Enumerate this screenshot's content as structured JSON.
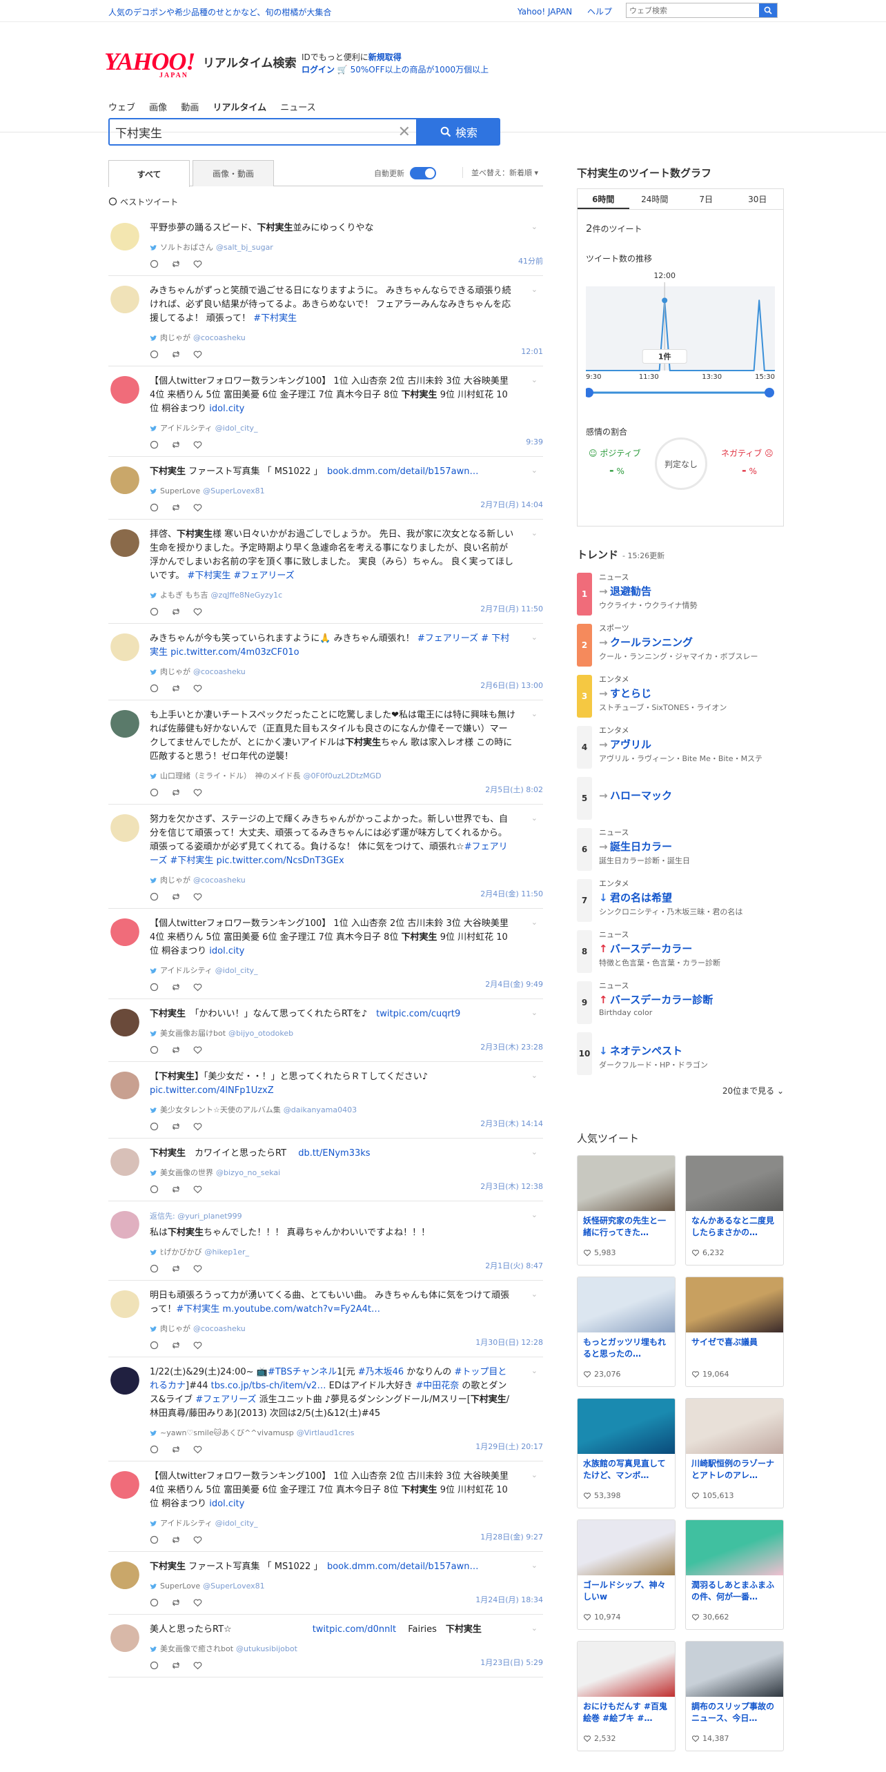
{
  "topbar": {
    "promo": "人気のデコポンや希少品種のせとかなど、旬の柑橘が大集合",
    "links": [
      "Yahoo! JAPAN",
      "ヘルプ"
    ],
    "web_search_placeholder": "ウェブ検索"
  },
  "header": {
    "logo": "YAHOO!",
    "logo_sub": "JAPAN",
    "title": "リアルタイム検索",
    "login_line1_a": "IDでもっと便利に",
    "login_line1_b": "新規取得",
    "login_line2_a": "ログイン",
    "login_line2_b": "50%OFF以上の商品が1000万個以上"
  },
  "nav": [
    "ウェブ",
    "画像",
    "動画",
    "リアルタイム",
    "ニュース"
  ],
  "search": {
    "value": "下村実生",
    "button": "検索"
  },
  "tabs": {
    "all": "すべて",
    "media": "画像・動画",
    "auto": "自動更新",
    "sort": "並べ替え：新着順"
  },
  "best_label": "ベストツイート",
  "tweets": [
    {
      "text": "平野歩夢の踊るスピード、<b>下村実生</b>並みにゆっくりやな",
      "user": "ソルトおばさん",
      "handle": "@salt_bj_sugar",
      "time": "41分前",
      "av": "#f3e6b0"
    },
    {
      "text": "みきちゃんがずっと笑顔で過ごせる日になりますように。 みきちゃんならできる&#xfe0f;頑張り続ければ、必ず良い結果が待ってるよ。あきらめないで！ フェアラーみんなみきちゃんを応援してるよ！ 頑張って！ <a>#下村実生</a>",
      "user": "肉じゃが",
      "handle": "@cocoasheku",
      "time": "12:01",
      "av": "#f0e2b8"
    },
    {
      "text": "【個人twitterフォロワー数ランキング100】 1位 入山杏奈 2位 古川未鈴 3位 大谷映美里 4位 来栖りん 5位 富田美憂 6位 金子理江 7位 真木今日子 8位 <b>下村実生</b> 9位 川村虹花 10位 桐谷まつり <a>idol.city</a>",
      "user": "アイドルシティ",
      "handle": "@idol_city_",
      "time": "9:39",
      "av": "#f06c7a"
    },
    {
      "text": "<b>下村実生</b> ファースト写真集 「 MS1022 」　<a>book.dmm.com/detail/b157awn…</a>",
      "user": "SuperLove",
      "handle": "@SuperLovex81",
      "time": "2月7日(月) 14:04",
      "av": "#c9a76a"
    },
    {
      "text": "拝啓、<b>下村実生</b>様 寒い日々いかがお過ごしでしょうか。 先日、我が家に次女となる新しい生命を授かりました。予定時期より早く急遽命名を考える事になりましたが、良い名前が浮かんでしまいお名前の字を頂く事に致しました。 実良（みら）ちゃん。 良く実ってほしいです。 <a>#下村実生 #フェアリーズ</a>",
      "user": "よもぎ もち吉",
      "handle": "@zqJffe8NeGyzy1c",
      "time": "2月7日(月) 11:50",
      "av": "#8a6a4a"
    },
    {
      "text": "みきちゃんが今も笑っていられますように&#x1f64f; みきちゃん頑張れ！ <a>#フェアリーズ # 下村実生</a> <a>pic.twitter.com/4m03zCF01o</a>",
      "user": "肉じゃが",
      "handle": "@cocoasheku",
      "time": "2月6日(日) 13:00",
      "av": "#f0e2b8"
    },
    {
      "text": "も上手いとか凄いチートスペックだったことに吃驚しました&#x2764;私は電王には特に興味も無ければ佐藤健も好かないんで（正直見た目もスタイルも良さのになんか偉そーで嫌い）マークしてませんでしたが、とにかく凄いアイドルは<b>下村実生</b>ちゃん 歌は家入レオ様 この時に匹敵すると思う！ゼロ年代の逆襲！",
      "user": "山口理緒（ミライ・ドル）　神のメイド長",
      "handle": "@0F0f0uzL2DtzMGD",
      "time": "2月5日(土) 8:02",
      "av": "#5a7a6a"
    },
    {
      "text": "努力を欠かさず、ステージの上で輝くみきちゃんがかっこよかった。新しい世界でも、自分を信じて頑張って！大丈夫、頑張ってるみきちゃんには必ず運が味方してくれるから。頑張ってる姿頑かが必ず見てくれてる。負けるな！ 体に気をつけて、頑張れ&#x2606;<a>#フェアリーズ #下村実生</a> <a>pic.twitter.com/NcsDnT3GEx</a>",
      "user": "肉じゃが",
      "handle": "@cocoasheku",
      "time": "2月4日(金) 11:50",
      "av": "#f0e2b8"
    },
    {
      "text": "【個人twitterフォロワー数ランキング100】 1位 入山杏奈 2位 古川未鈴 3位 大谷映美里 4位 来栖りん 5位 富田美憂 6位 金子理江 7位 真木今日子 8位 <b>下村実生</b> 9位 川村虹花 10位 桐谷まつり <a>idol.city</a>",
      "user": "アイドルシティ",
      "handle": "@idol_city_",
      "time": "2月4日(金) 9:49",
      "av": "#f06c7a"
    },
    {
      "text": "<b>下村実生</b>　「かわいい！」なんて思ってくれたらRTを♪　<a>twitpic.com/cuqrt9</a>",
      "user": "美女画像お届けbot",
      "handle": "@bijyo_otodokeb",
      "time": "2月3日(木) 23:28",
      "av": "#6a4a3a"
    },
    {
      "text": "【<b>下村実生</b>】「美少女だ・・！」と思ってくれたらＲＴしてください♪ <a>pic.twitter.com/4lNFp1UzxZ</a>",
      "user": "美少女タレント☆天使のアルバム集",
      "handle": "@daikanyama0403",
      "time": "2月3日(木) 14:14",
      "av": "#c8a090"
    },
    {
      "text": "<b>下村実生</b>　カワイイと思ったらRT　 <a>db.tt/ENym33ks</a>",
      "user": "美女画像の世界",
      "handle": "@bizyo_no_sekai",
      "time": "2月3日(木) 12:38",
      "av": "#d8c0b8"
    },
    {
      "reply": "返信先: @yuri_planet999",
      "text": "私は<b>下村実生</b>ちゃんでした！！！ 真尋ちゃんかわいいですよね！！！",
      "user": "ﾋげかびかび",
      "handle": "@hikep1er_",
      "time": "2月1日(火) 8:47",
      "av": "#e0b0c0"
    },
    {
      "text": "明日も頑張ろうって力が湧いてくる曲、とてもいい曲。 みきちゃんも体に気をつけて頑張って！<a>#下村実生</a> <a>m.youtube.com/watch?v=Fy2A4t…</a>",
      "user": "肉じゃが",
      "handle": "@cocoasheku",
      "time": "1月30日(日) 12:28",
      "av": "#f0e2b8"
    },
    {
      "text": "1/22(土)&29(土)24:00~ &#x1f4fa;<a>#TBSチャンネル</a>1[元 <a>#乃木坂46</a> かなりんの <a>#トップ目とれるカナ</a>]#44 <a>tbs.co.jp/tbs-ch/item/v2…</a> EDはアイドル大好き <a>#中田花奈</a> の歌とダンス&ライブ <a>#フェアリーズ</a> 派生ユニット曲 ♪夢見るダンシングドール/Mスリー[<b>下村実生</b>/林田真尋/藤田みりあ](2013) 次回は2/5(土)&12(土)#45",
      "user": "~yawn&#x2661;smile&#x1f431;あくび^^vivamusp",
      "handle": "@Virtlaud1cres",
      "time": "1月29日(土) 20:17",
      "av": "#202040"
    },
    {
      "text": "【個人twitterフォロワー数ランキング100】 1位 入山杏奈 2位 古川未鈴 3位 大谷映美里 4位 来栖りん 5位 富田美憂 6位 金子理江 7位 真木今日子 8位 <b>下村実生</b> 9位 川村虹花 10位 桐谷まつり <a>idol.city</a>",
      "user": "アイドルシティ",
      "handle": "@idol_city_",
      "time": "1月28日(金) 9:27",
      "av": "#f06c7a"
    },
    {
      "text": "<b>下村実生</b> ファースト写真集 「 MS1022 」　<a>book.dmm.com/detail/b157awn…</a>",
      "user": "SuperLove",
      "handle": "@SuperLovex81",
      "time": "1月24日(月) 18:34",
      "av": "#c9a76a"
    },
    {
      "text": "美人と思ったらRT☆　　　　　　　　　<a>twitpic.com/d0nnlt</a>　 Fairies　<b>下村実生</b>",
      "user": "美女画像で癒されbot",
      "handle": "@utukusibijobot",
      "time": "1月23日(日) 5:29",
      "av": "#d8b8a8"
    }
  ],
  "side": {
    "graph_title": "下村実生のツイート数グラフ",
    "graph_tabs": [
      "6時間",
      "24時間",
      "7日",
      "30日"
    ],
    "count_num": "2",
    "count_unit": "件のツイート",
    "graph_sub": "ツイート数の推移",
    "feel_title": "感情の割合",
    "positive": "ポジティブ",
    "negative": "ネガティブ",
    "neutral": "判定なし",
    "dash": "-",
    "pct": "%",
    "trend_title": "トレンド",
    "trend_updated": "15:26更新",
    "trends": [
      {
        "rank": "1",
        "cat": "ニュース",
        "name": "退避勧告",
        "rel": "ウクライナ・ウクライナ情勢",
        "color": "#f06c7a",
        "arw": "→",
        "arwcolor": "#999"
      },
      {
        "rank": "2",
        "cat": "スポーツ",
        "name": "クールランニング",
        "rel": "クール・ランニング・ジャマイカ・ボブスレー",
        "color": "#f58a5c",
        "arw": "→",
        "arwcolor": "#999"
      },
      {
        "rank": "3",
        "cat": "エンタメ",
        "name": "すとらじ",
        "rel": "ストチューブ・SixTONES・ライオン",
        "color": "#f5c842",
        "arw": "→",
        "arwcolor": "#999"
      },
      {
        "rank": "4",
        "cat": "エンタメ",
        "name": "アヴリル",
        "rel": "アヴリル・ラヴィーン・Bite Me・Bite・Mステ",
        "color": "#f3f3f3",
        "arw": "→",
        "arwcolor": "#999"
      },
      {
        "rank": "5",
        "cat": "",
        "name": "ハローマック",
        "rel": "",
        "color": "#f3f3f3",
        "arw": "→",
        "arwcolor": "#999"
      },
      {
        "rank": "6",
        "cat": "ニュース",
        "name": "誕生日カラー",
        "rel": "誕生日カラー診断・誕生日",
        "color": "#f3f3f3",
        "arw": "→",
        "arwcolor": "#999"
      },
      {
        "rank": "7",
        "cat": "エンタメ",
        "name": "君の名は希望",
        "rel": "シンクロニシティ・乃木坂三昧・君の名は",
        "color": "#f3f3f3",
        "arw": "↓",
        "arwcolor": "#2f74e0"
      },
      {
        "rank": "8",
        "cat": "ニュース",
        "name": "バースデーカラー",
        "rel": "特徴と色言葉・色言葉・カラー診断",
        "color": "#f3f3f3",
        "arw": "↑",
        "arwcolor": "#e03040"
      },
      {
        "rank": "9",
        "cat": "ニュース",
        "name": "バースデーカラー診断",
        "rel": "Birthday color",
        "color": "#f3f3f3",
        "arw": "↑",
        "arwcolor": "#e03040"
      },
      {
        "rank": "10",
        "cat": "",
        "name": "ネオテンペスト",
        "rel": "ダークフルード・HP・ドラゴン",
        "color": "#f3f3f3",
        "arw": "↓",
        "arwcolor": "#2f74e0"
      }
    ],
    "more": "20位まで見る",
    "pop_title": "人気ツイート",
    "pops": [
      {
        "text": "妖怪研究家の先生と一緒に行ってきた…",
        "likes": "5,983",
        "c1": "#c8c8c0",
        "c2": "#6a5a4a"
      },
      {
        "text": "なんかあるなと二度見したらまさかの…",
        "likes": "6,232",
        "c1": "#8a8a88",
        "c2": "#5a5a58"
      },
      {
        "text": "もっとガッツリ埋もれると思ったの…",
        "likes": "23,076",
        "c1": "#dce6f0",
        "c2": "#8aa0c0"
      },
      {
        "text": "サイゼで喜ぶ議員",
        "likes": "19,064",
        "c1": "#c8a060",
        "c2": "#3a2a2a"
      },
      {
        "text": "水族館の写真見直してたけど、マンボ…",
        "likes": "53,398",
        "c1": "#1a8ab0",
        "c2": "#0a4a7a"
      },
      {
        "text": "川崎駅恒例のラゾーナとアトレのアレ…",
        "likes": "105,613",
        "c1": "#e8e0d8",
        "c2": "#c0a8a0"
      },
      {
        "text": "ゴールドシップ、神々しいw",
        "likes": "10,974",
        "c1": "#e8e8f0",
        "c2": "#a08050"
      },
      {
        "text": "潤羽るしあとまふまふの件、何が一番…",
        "likes": "30,662",
        "c1": "#40c0a0",
        "c2": "#f0c0d0"
      },
      {
        "text": "おにけもだんす #百鬼絵巻 #絵ブキ #…",
        "likes": "2,532",
        "c1": "#f0f0f0",
        "c2": "#c03030"
      },
      {
        "text": "調布のスリップ事故のニュース、今日…",
        "likes": "14,387",
        "c1": "#c8d0d8",
        "c2": "#303840"
      }
    ]
  },
  "chart_data": {
    "type": "line",
    "title": "",
    "x_ticks": [
      "9:30",
      "11:30",
      "13:30",
      "15:30"
    ],
    "marker_label": "12:00",
    "tooltip": "1件",
    "x": [
      "9:30",
      "10:00",
      "10:30",
      "11:00",
      "11:30",
      "11:50",
      "12:00",
      "12:10",
      "12:30",
      "13:00",
      "13:30",
      "14:00",
      "14:30",
      "14:50",
      "15:00",
      "15:10",
      "15:30"
    ],
    "values": [
      0,
      0,
      0,
      0,
      0,
      0,
      1,
      0,
      0,
      0,
      0,
      0,
      0,
      0,
      1,
      0,
      0
    ],
    "ylim": [
      0,
      1.2
    ]
  }
}
